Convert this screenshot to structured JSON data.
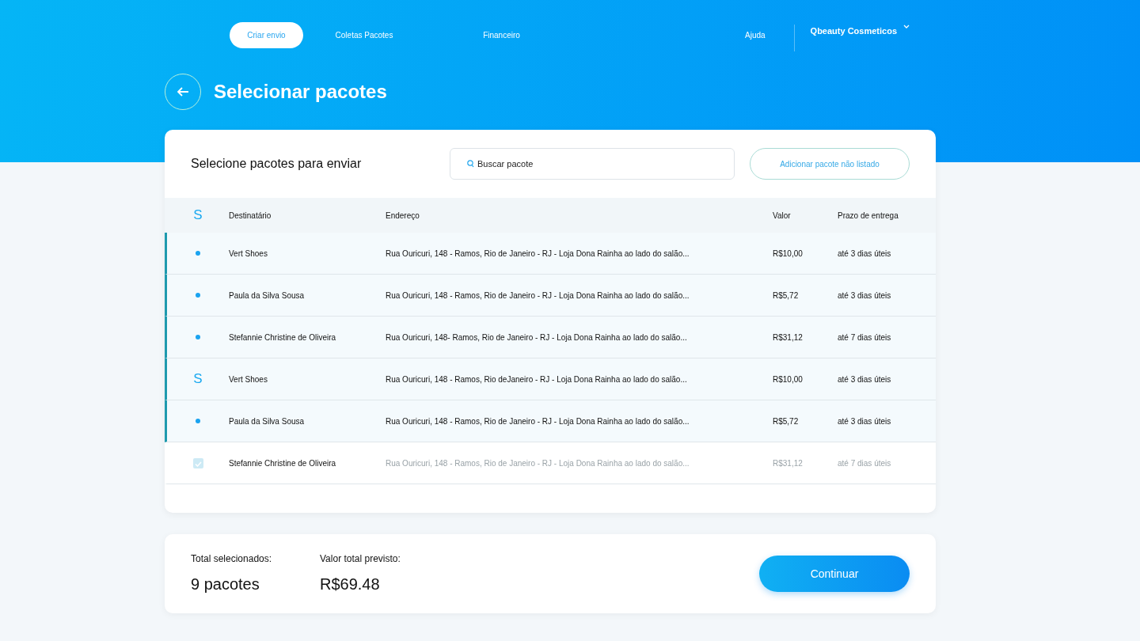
{
  "nav": {
    "items": [
      {
        "label": "Criar envio",
        "selected": true
      },
      {
        "label": "Coletas Pacotes",
        "selected": false
      },
      {
        "label": "Financeiro",
        "selected": false
      }
    ],
    "help": "Ajuda",
    "account": {
      "name": "Qbeauty Cosmeticos"
    }
  },
  "page_title": "Selecionar pacotes",
  "packages": {
    "heading": "Selecione pacotes para enviar",
    "search": {
      "placeholder": "Buscar pacote"
    },
    "add_button": "Adicionar pacote não listado",
    "columns": {
      "marker": "S",
      "recipient": "Destinatário",
      "address": "Endereço",
      "value": "Valor",
      "deadline": "Prazo de entrega"
    },
    "rows": [
      {
        "kind": "dot",
        "selected": true,
        "faded": false,
        "recipient": "Vert Shoes",
        "address": "Rua Ouricuri, 148 - Ramos, Rio de Janeiro - RJ - Loja Dona Rainha ao lado do salão...",
        "value": "R$10,00",
        "deadline": "até 3 dias úteis"
      },
      {
        "kind": "dot",
        "selected": true,
        "faded": false,
        "recipient": "Paula da Silva Sousa",
        "address": "Rua Ouricuri, 148 - Ramos, Rio de Janeiro - RJ - Loja Dona Rainha ao lado do salão...",
        "value": "R$5,72",
        "deadline": "até 3 dias úteis"
      },
      {
        "kind": "dot",
        "selected": true,
        "faded": false,
        "recipient": "Stefannie Christine de Oliveira",
        "address": "Rua Ouricuri, 148- Ramos, Rio de Janeiro - RJ - Loja Dona Rainha ao lado do salão...",
        "value": "R$31,12",
        "deadline": "até 7 dias úteis"
      },
      {
        "kind": "letter",
        "marker": "S",
        "selected": true,
        "faded": false,
        "recipient": "Vert Shoes",
        "address": "Rua Ouricuri, 148 - Ramos, Rio deJaneiro - RJ - Loja Dona Rainha ao lado do salão...",
        "value": "R$10,00",
        "deadline": "até 3 dias úteis"
      },
      {
        "kind": "dot",
        "selected": true,
        "faded": false,
        "recipient": "Paula da Silva Sousa",
        "address": "Rua Ouricuri, 148 - Ramos, Rio de Janeiro - RJ - Loja Dona Rainha ao lado do salão...",
        "value": "R$5,72",
        "deadline": "até 3 dias úteis"
      },
      {
        "kind": "checkbox",
        "checked": true,
        "selected": false,
        "faded": true,
        "recipient": "Stefannie Christine de Oliveira",
        "address": "Rua Ouricuri, 148 - Ramos, Rio de Janeiro - RJ - Loja Dona Rainha ao lado do salão...",
        "value": "R$31,12",
        "deadline": "até 7 dias úteis"
      }
    ]
  },
  "summary": {
    "count_label": "Total selecionados:",
    "count": "9 pacotes",
    "total_label": "Valor total previsto:",
    "total": "R$69.48",
    "continue_button": "Continuar"
  }
}
